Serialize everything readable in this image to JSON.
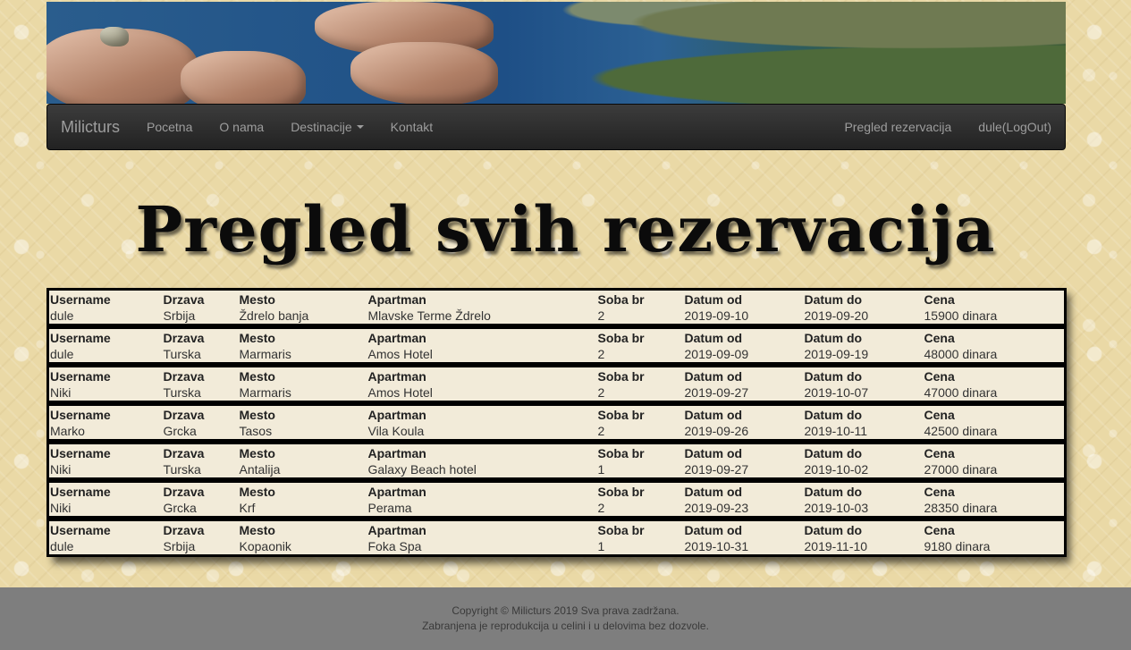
{
  "navbar": {
    "brand": "Milicturs",
    "items": [
      "Pocetna",
      "O nama",
      "Destinacije",
      "Kontakt"
    ],
    "right_items": [
      "Pregled rezervacija",
      "dule(LogOut)"
    ]
  },
  "page_title": "Pregled svih rezervacija",
  "table_headers": [
    "Username",
    "Drzava",
    "Mesto",
    "Apartman",
    "Soba br",
    "Datum od",
    "Datum do",
    "Cena"
  ],
  "reservations": [
    [
      "dule",
      "Srbija",
      "Ždrelo banja",
      "Mlavske Terme Ždrelo",
      "2",
      "2019-09-10",
      "2019-09-20",
      "15900 dinara"
    ],
    [
      "dule",
      "Turska",
      "Marmaris",
      "Amos Hotel",
      "2",
      "2019-09-09",
      "2019-09-19",
      "48000 dinara"
    ],
    [
      "Niki",
      "Turska",
      "Marmaris",
      "Amos Hotel",
      "2",
      "2019-09-27",
      "2019-10-07",
      "47000 dinara"
    ],
    [
      "Marko",
      "Grcka",
      "Tasos",
      "Vila Koula",
      "2",
      "2019-09-26",
      "2019-10-11",
      "42500 dinara"
    ],
    [
      "Niki",
      "Turska",
      "Antalija",
      "Galaxy Beach hotel",
      "1",
      "2019-09-27",
      "2019-10-02",
      "27000 dinara"
    ],
    [
      "Niki",
      "Grcka",
      "Krf",
      "Perama",
      "2",
      "2019-09-23",
      "2019-10-03",
      "28350 dinara"
    ],
    [
      "dule",
      "Srbija",
      "Kopaonik",
      "Foka Spa",
      "1",
      "2019-10-31",
      "2019-11-10",
      "9180 dinara"
    ]
  ],
  "footer": {
    "line1": "Copyright © Milicturs 2019 Sva prava zadržana.",
    "line2": "Zabranjena je reprodukcija u celini i u delovima bez dozvole."
  },
  "colors": {
    "navbar": "#222222",
    "nav_text": "#9d9d9d",
    "table_bg": "#f2ebd9",
    "footer_bg": "#7e7e7e"
  }
}
